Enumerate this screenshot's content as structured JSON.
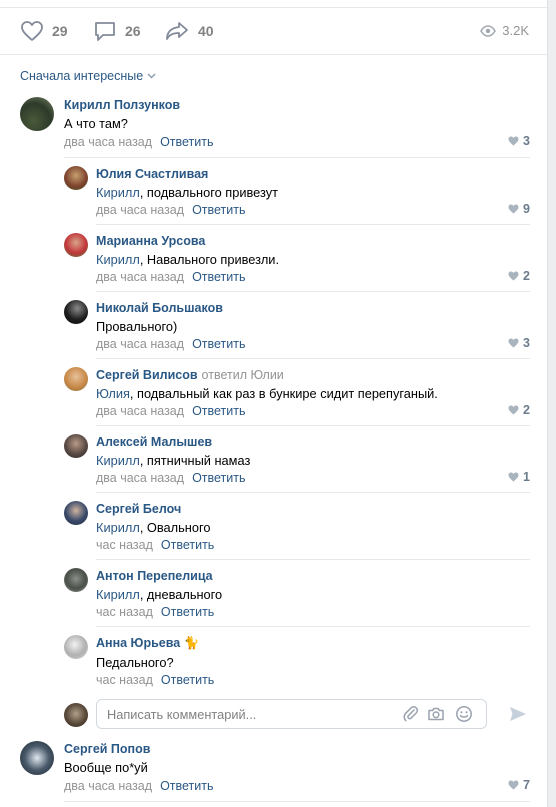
{
  "actions": {
    "likes": "29",
    "comments": "26",
    "shares": "40",
    "views": "3.2K"
  },
  "sort_label": "Сначала интересные",
  "reply_label": "Ответить",
  "composer_placeholder": "Написать комментарий...",
  "comments": [
    {
      "name": "Кирилл Ползунков",
      "reply_to": "",
      "addressee": "",
      "text": "А что там?",
      "time": "два часа назад",
      "likes": "3"
    },
    {
      "name": "Юлия Счастливая",
      "reply_to": "",
      "addressee": "Кирилл",
      "text": ", подвального привезут",
      "time": "два часа назад",
      "likes": "9"
    },
    {
      "name": "Марианна Урсова",
      "reply_to": "",
      "addressee": "Кирилл",
      "text": ", Навального привезли.",
      "time": "два часа назад",
      "likes": "2"
    },
    {
      "name": "Николай Большаков",
      "reply_to": "",
      "addressee": "",
      "text": "Провального)",
      "time": "два часа назад",
      "likes": "3"
    },
    {
      "name": "Сергей Вилисов",
      "reply_to": "ответил Юлии",
      "addressee": "Юлия",
      "text": ", подвальный как раз в бункире сидит перепуганый.",
      "time": "два часа назад",
      "likes": "2"
    },
    {
      "name": "Алексей Малышев",
      "reply_to": "",
      "addressee": "Кирилл",
      "text": ", пятничный намаз",
      "time": "два часа назад",
      "likes": "1"
    },
    {
      "name": "Сергей Белоч",
      "reply_to": "",
      "addressee": "Кирилл",
      "text": ", Овального",
      "time": "час назад",
      "likes": ""
    },
    {
      "name": "Антон Перепелица",
      "reply_to": "",
      "addressee": "Кирилл",
      "text": ", дневального",
      "time": "час назад",
      "likes": ""
    },
    {
      "name": "Анна Юрьева",
      "reply_to": "",
      "addressee": "",
      "text": "Педального?",
      "time": "час назад",
      "likes": ""
    },
    {
      "name": "Сергей Попов",
      "reply_to": "",
      "addressee": "",
      "text": "Вообще по*уй",
      "time": "два часа назад",
      "likes": "7"
    }
  ]
}
